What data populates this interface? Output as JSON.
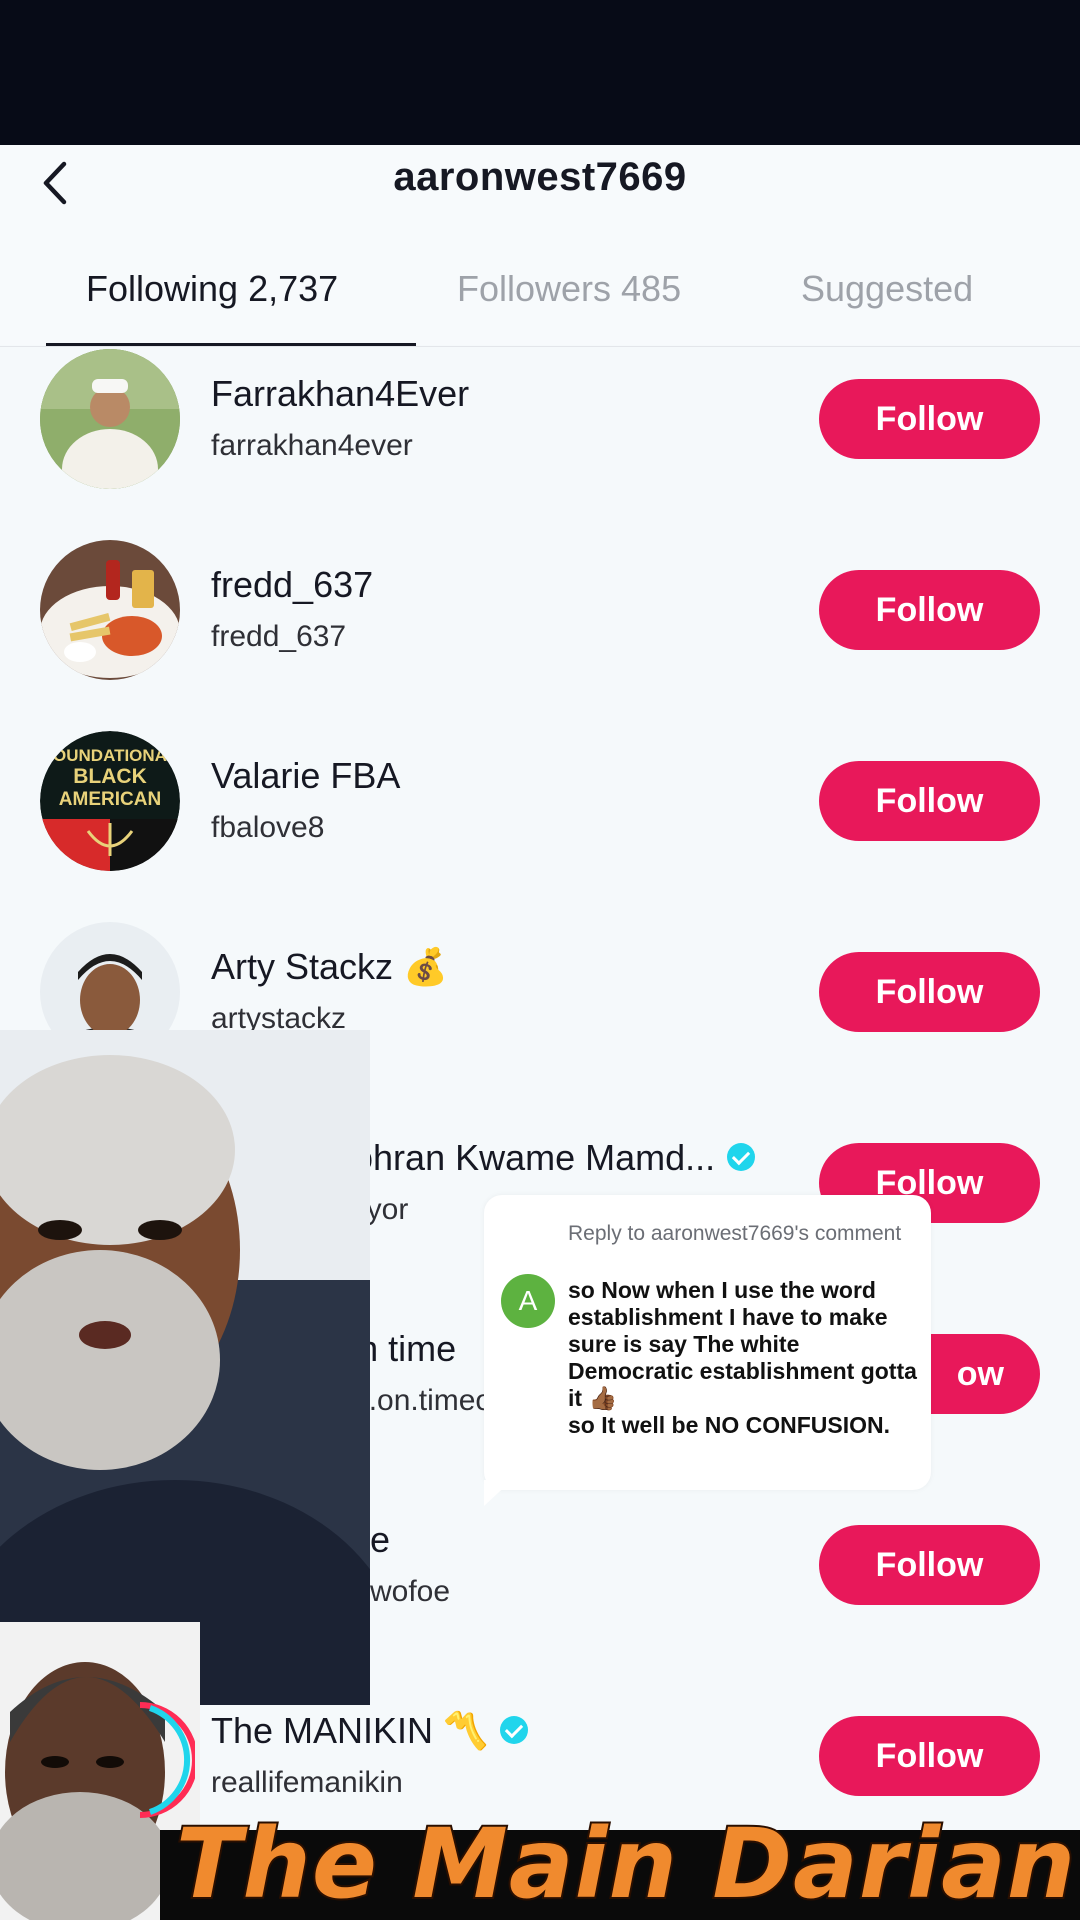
{
  "header": {
    "title": "aaronwest7669"
  },
  "tabs": [
    {
      "label": "Following 2,737",
      "active": true
    },
    {
      "label": "Followers 485",
      "active": false
    },
    {
      "label": "Suggested",
      "active": false
    }
  ],
  "users": [
    {
      "name": "Farrakhan4Ever",
      "handle": "farrakhan4ever",
      "button": "Follow"
    },
    {
      "name": "fredd_637",
      "handle": "fredd_637",
      "button": "Follow"
    },
    {
      "name": "Valarie FBA",
      "handle": "fbalove8",
      "button": "Follow"
    },
    {
      "name": "Arty Stackz 💰",
      "handle": "artystackz",
      "button": "Follow"
    },
    {
      "name": "Mayor Zohran Kwame Mamd...",
      "handle": "ycmayor",
      "button": "Follow",
      "verified": true
    },
    {
      "name": "Donnie on time",
      "handle": "nnie.on.timeout",
      "button": "ow"
    },
    {
      "name": "e",
      "handle": "wofoe",
      "button": "Follow"
    },
    {
      "name": "The MANIKIN 〽️",
      "handle": "reallifemanikin",
      "button": "Follow",
      "verified": true
    }
  ],
  "avatar_badge": {
    "text": "FOUNDATIONAL BLACK AMERICAN"
  },
  "reply": {
    "header": "Reply to aaronwest7669's comment",
    "avatar_letter": "A",
    "text": "so Now when I use the word establishment I have to make sure is say The white Democratic establishment gotta it 👍🏾\nso It well be NO CONFUSION."
  },
  "watermark": {
    "text": "The Main Darian"
  },
  "colors": {
    "follow_button": "#e8185a",
    "verified_badge": "#20d5ec",
    "brand_text": "#f08a2e"
  }
}
